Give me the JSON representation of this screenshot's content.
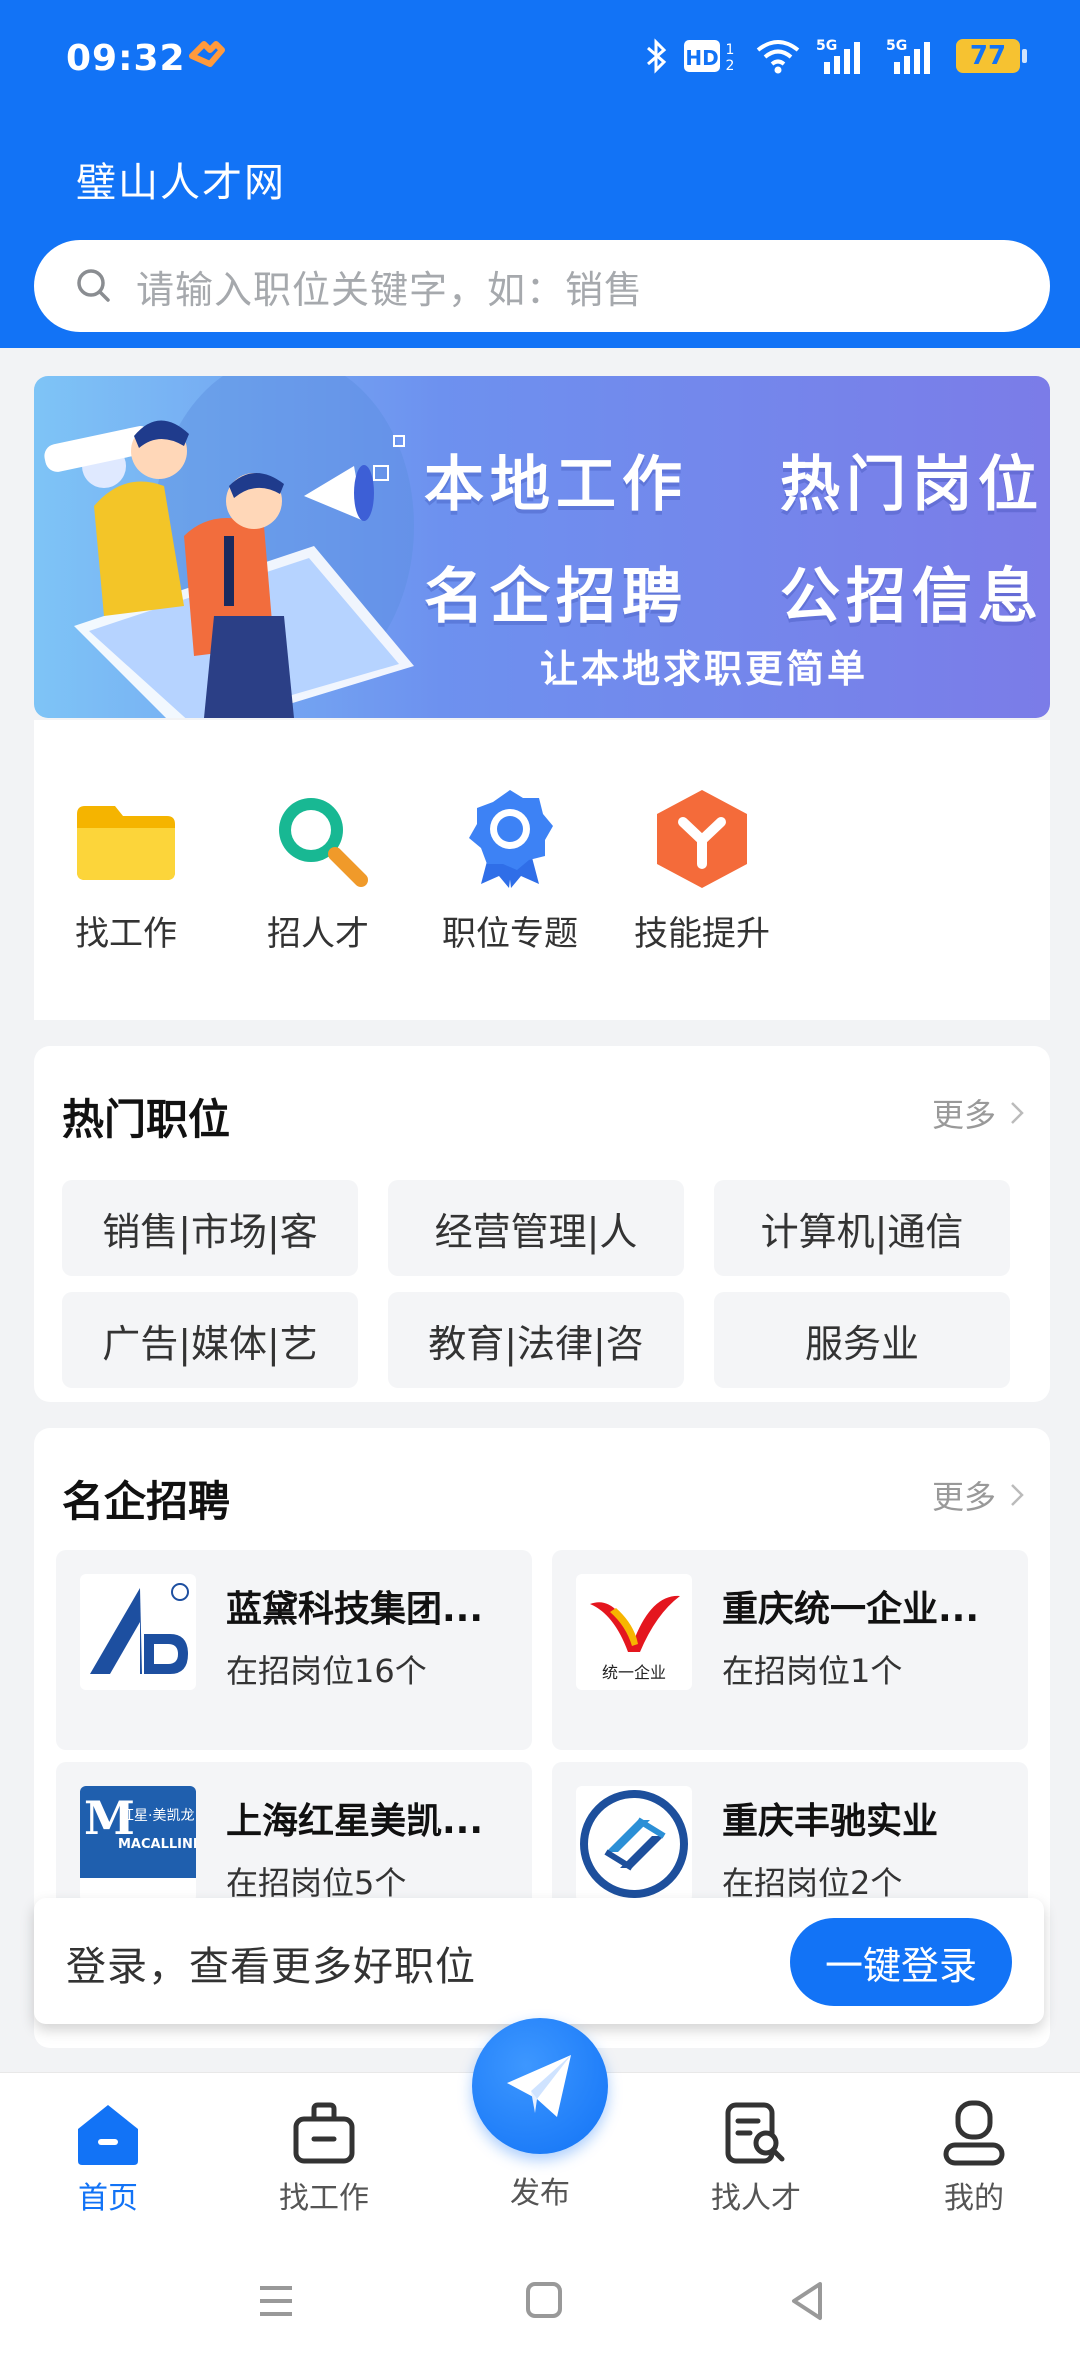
{
  "status_bar": {
    "time": "09:32",
    "hd_label": "HD",
    "net1": "5G",
    "net2": "5G",
    "battery": "77"
  },
  "header": {
    "title": "璧山人才网",
    "search_placeholder": "请输入职位关键字，如：销售"
  },
  "banner": {
    "line1": [
      "本地工作",
      "热门岗位"
    ],
    "line2": [
      "名企招聘",
      "公招信息"
    ],
    "subtitle": "让本地求职更简单"
  },
  "quick_nav": [
    {
      "label": "找工作",
      "icon": "folder-icon"
    },
    {
      "label": "招人才",
      "icon": "magnifier-icon"
    },
    {
      "label": "职位专题",
      "icon": "badge-icon"
    },
    {
      "label": "技能提升",
      "icon": "skill-hexagon-icon"
    }
  ],
  "hot_jobs": {
    "title": "热门职位",
    "more": "更多",
    "tags": [
      "销售|市场|客",
      "经营管理|人",
      "计算机|通信",
      "广告|媒体|艺",
      "教育|法律|咨",
      "服务业"
    ]
  },
  "companies": {
    "title": "名企招聘",
    "more": "更多",
    "items": [
      {
        "name": "蓝黛科技集团...",
        "count": "在招岗位16个"
      },
      {
        "name": "重庆统一企业...",
        "count": "在招岗位1个"
      },
      {
        "name": "上海红星美凯...",
        "count": "在招岗位5个"
      },
      {
        "name": "重庆丰驰实业",
        "count": "在招岗位2个"
      }
    ],
    "logo_texts": {
      "tongyi": "统一企业",
      "hongxing_top": "红星·美凯龙",
      "hongxing_bottom": "MACALLINE"
    }
  },
  "login_prompt": {
    "text": "登录，查看更多好职位",
    "button": "一键登录"
  },
  "tabbar": {
    "home": "首页",
    "find_job": "找工作",
    "publish": "发布",
    "find_talent": "找人才",
    "mine": "我的"
  },
  "colors": {
    "primary": "#1273f6",
    "banner_start": "#7ec4f6",
    "banner_end": "#7b7ce8"
  }
}
